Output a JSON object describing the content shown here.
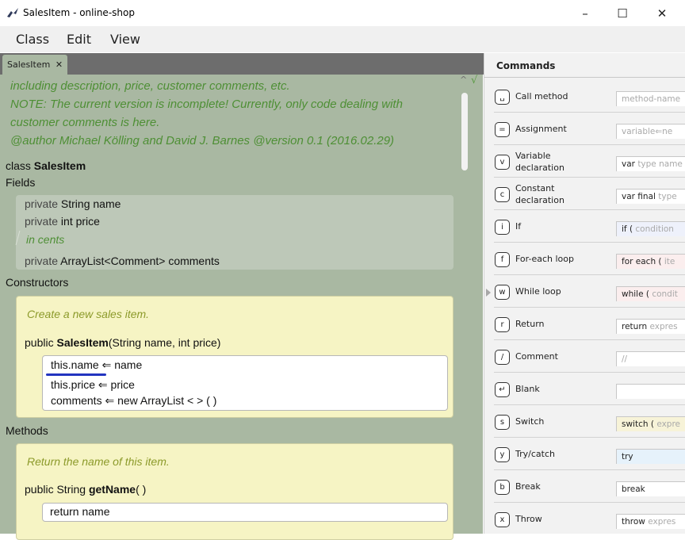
{
  "window": {
    "title": "SalesItem - online-shop",
    "minimize": "–",
    "maximize": "☐",
    "close": "✕"
  },
  "menu": [
    "Class",
    "Edit",
    "View"
  ],
  "tab": {
    "label": "SalesItem",
    "close": "✕"
  },
  "editor": {
    "doc_lines": [
      "including description, price, customer comments, etc.",
      "NOTE: The current version is incomplete! Currently, only code dealing with",
      "customer comments is here.",
      "@author Michael Kölling and David J. Barnes @version 0.1 (2016.02.29)"
    ],
    "class_kw": "class",
    "class_name": "SalesItem",
    "fields_label": "Fields",
    "fields": {
      "f1_kw": "private",
      "f1_rest": "String name",
      "f2_kw": "private",
      "f2_rest": "int price",
      "f2_comment": "in cents",
      "f3_kw": "private",
      "f3_rest": "ArrayList<Comment>  comments"
    },
    "constructors_label": "Constructors",
    "ctor": {
      "doc": "Create a new sales item.",
      "kw": "public",
      "name": "SalesItem",
      "params": "(String name,  int price)",
      "line1": "this.name ⇐ name",
      "line2": "this.price ⇐ price",
      "line3": "comments ⇐  new  ArrayList <  > ( )"
    },
    "methods_label": "Methods",
    "method": {
      "doc": "Return the name of this item.",
      "sig_pre": "public String ",
      "name": "getName",
      "parens": "( )",
      "body": "return name"
    },
    "check": "√",
    "caret": "^"
  },
  "commands": {
    "header": "Commands",
    "items": [
      {
        "key": "␣",
        "label": "Call method",
        "preview": "",
        "placeholder": "method-name",
        "color": "#ffffff"
      },
      {
        "key": "=",
        "label": "Assignment",
        "preview": "",
        "placeholder": "variable⇐ne",
        "color": "#ffffff"
      },
      {
        "key": "v",
        "label": "Variable declaration",
        "preview": "var",
        "placeholder": "type name",
        "color": "#ffffff"
      },
      {
        "key": "c",
        "label": "Constant declaration",
        "preview": "var final",
        "placeholder": "type",
        "color": "#ffffff"
      },
      {
        "key": "i",
        "label": "If",
        "preview": "if (",
        "placeholder": "condition",
        "color": "#eef1fb"
      },
      {
        "key": "f",
        "label": "For-each loop",
        "preview": "for each (",
        "placeholder": "ite",
        "color": "#fbeeee"
      },
      {
        "key": "w",
        "label": "While loop",
        "preview": "while (",
        "placeholder": "condit",
        "color": "#fbeeee"
      },
      {
        "key": "r",
        "label": "Return",
        "preview": "return",
        "placeholder": "expres",
        "color": "#ffffff"
      },
      {
        "key": "/",
        "label": "Comment",
        "preview": "",
        "placeholder": "//",
        "color": "#ffffff"
      },
      {
        "key": "↵",
        "label": "Blank",
        "preview": "",
        "placeholder": "",
        "color": "#ffffff"
      },
      {
        "key": "s",
        "label": "Switch",
        "preview": "switch (",
        "placeholder": "expre",
        "color": "#f7f3d8"
      },
      {
        "key": "y",
        "label": "Try/catch",
        "preview": "try",
        "placeholder": "",
        "color": "#e6f2fb"
      },
      {
        "key": "b",
        "label": "Break",
        "preview": "break",
        "placeholder": "",
        "color": "#ffffff"
      },
      {
        "key": "x",
        "label": "Throw",
        "preview": "throw",
        "placeholder": "expres",
        "color": "#ffffff"
      }
    ]
  }
}
